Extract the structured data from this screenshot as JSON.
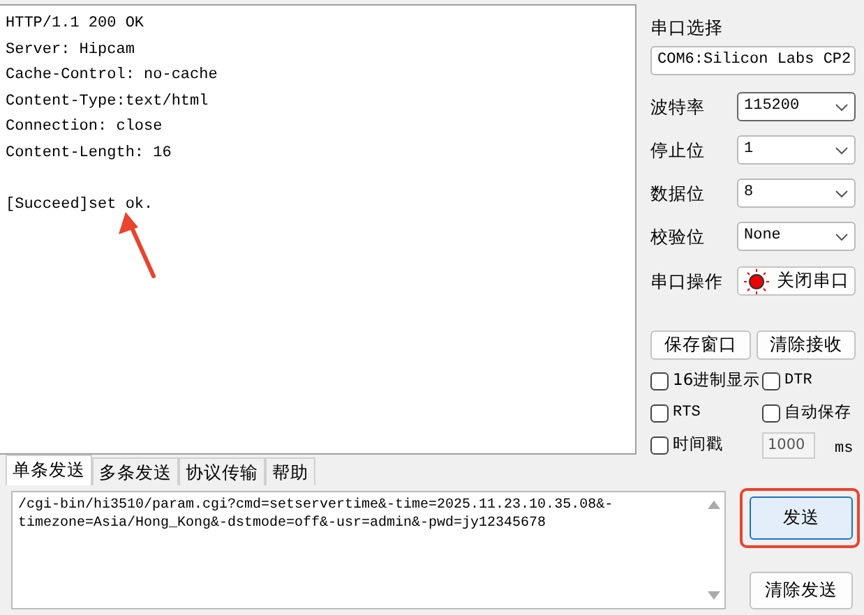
{
  "receive_log": {
    "headers": [
      "HTTP/1.1 200 OK",
      "Server: Hipcam",
      "Cache-Control: no-cache",
      "Content-Type:text/html",
      "Connection: close",
      "Content-Length: 16"
    ],
    "body": "[Succeed]set ok."
  },
  "serial_panel": {
    "port_label": "串口选择",
    "port_value": "COM6:Silicon Labs CP2",
    "settings": [
      {
        "label": "波特率",
        "value": "115200",
        "selected": true
      },
      {
        "label": "停止位",
        "value": "1",
        "selected": false
      },
      {
        "label": "数据位",
        "value": "8",
        "selected": false
      },
      {
        "label": "校验位",
        "value": "None",
        "selected": false
      }
    ],
    "operation_label": "串口操作",
    "port_button": {
      "label": "关闭串口",
      "open": true
    },
    "buttons": [
      "保存窗口",
      "清除接收"
    ],
    "options": [
      {
        "label": "16进制显示",
        "checked": false
      },
      {
        "label": "DTR",
        "checked": false
      },
      {
        "label": "RTS",
        "checked": false
      },
      {
        "label": "自动保存",
        "checked": false
      },
      {
        "label": "时间戳",
        "checked": false
      }
    ],
    "interval": {
      "value": "1000",
      "disabled": true,
      "unit": "ms"
    }
  },
  "send_tabs": [
    {
      "label": "单条发送",
      "selected": true
    },
    {
      "label": "多条发送",
      "selected": false
    },
    {
      "label": "协议传输",
      "selected": false
    },
    {
      "label": "帮助",
      "selected": false
    }
  ],
  "send_text": "/cgi-bin/hi3510/param.cgi?cmd=setservertime&-time=2025.11.23.10.35.08&-timezone=Asia/Hong_Kong&-dstmode=off&-usr=admin&-pwd=jy12345678",
  "send_button": {
    "label": "发送",
    "highlighted": true
  },
  "clear_send_button": "清除发送"
}
